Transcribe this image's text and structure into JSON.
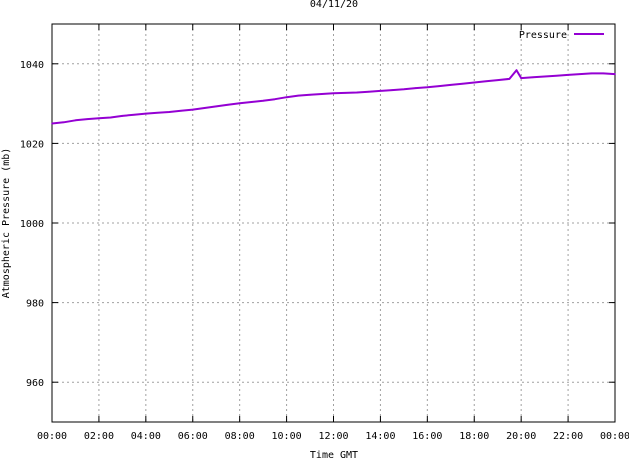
{
  "chart_data": {
    "type": "line",
    "title": "04/11/20",
    "xlabel": "Time GMT",
    "ylabel": "Atmospheric Pressure (mb)",
    "x_ticks": [
      "00:00",
      "02:00",
      "04:00",
      "06:00",
      "08:00",
      "10:00",
      "12:00",
      "14:00",
      "16:00",
      "18:00",
      "20:00",
      "22:00",
      "00:00"
    ],
    "y_ticks": [
      960,
      980,
      1000,
      1020,
      1040
    ],
    "xlim_hours": [
      0,
      24
    ],
    "ylim": [
      950,
      1050
    ],
    "grid": true,
    "legend_position": "top-right",
    "series": [
      {
        "name": "Pressure",
        "color": "#9400d3",
        "x_hours": [
          0,
          0.5,
          1,
          1.5,
          2,
          2.5,
          3,
          3.5,
          4,
          4.5,
          5,
          5.5,
          6,
          6.5,
          7,
          7.5,
          8,
          8.5,
          9,
          9.5,
          10,
          10.5,
          11,
          11.5,
          12,
          12.5,
          13,
          13.5,
          14,
          14.5,
          15,
          15.5,
          16,
          16.5,
          17,
          17.5,
          18,
          18.5,
          19,
          19.5,
          19.8,
          20,
          20.5,
          21,
          21.5,
          22,
          22.5,
          23,
          23.5,
          24
        ],
        "values": [
          1025.0,
          1025.3,
          1025.8,
          1026.1,
          1026.3,
          1026.5,
          1026.9,
          1027.2,
          1027.5,
          1027.7,
          1027.9,
          1028.2,
          1028.5,
          1028.9,
          1029.3,
          1029.7,
          1030.1,
          1030.4,
          1030.7,
          1031.1,
          1031.6,
          1032.0,
          1032.2,
          1032.4,
          1032.6,
          1032.7,
          1032.8,
          1033.0,
          1033.2,
          1033.4,
          1033.6,
          1033.9,
          1034.1,
          1034.4,
          1034.7,
          1035.0,
          1035.3,
          1035.6,
          1035.9,
          1036.2,
          1038.4,
          1036.4,
          1036.6,
          1036.8,
          1037.0,
          1037.2,
          1037.4,
          1037.6,
          1037.6,
          1037.4
        ]
      }
    ]
  }
}
